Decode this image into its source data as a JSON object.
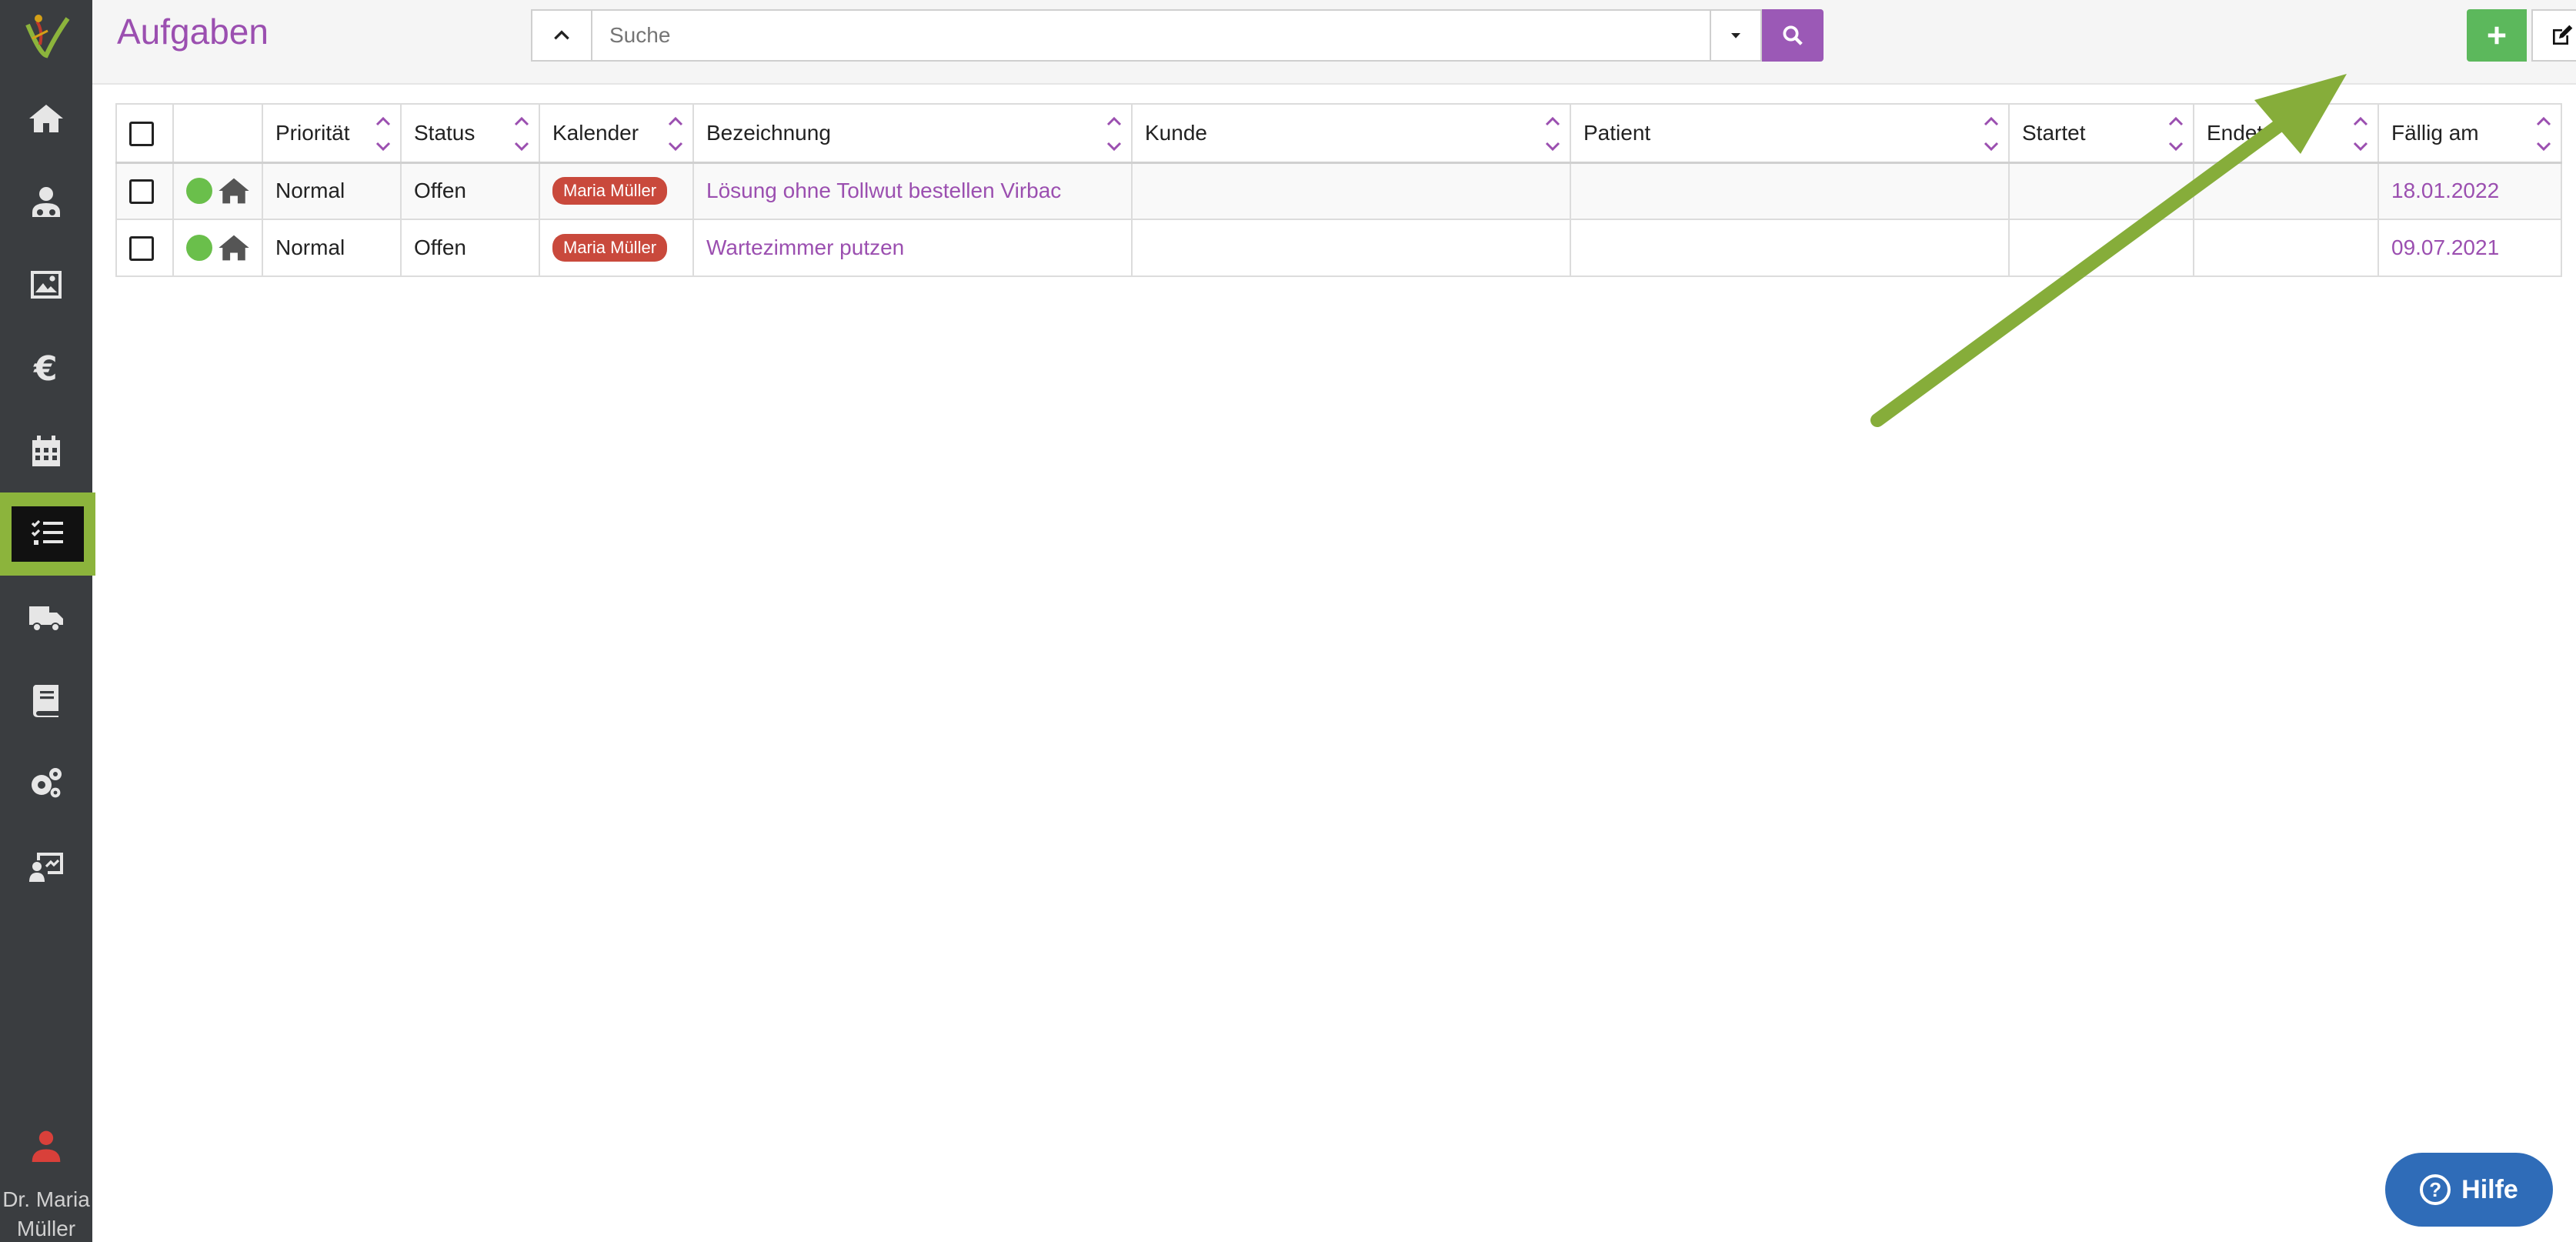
{
  "sidebar": {
    "nav_items": [
      {
        "icon": "home-icon"
      },
      {
        "icon": "customers-icon"
      },
      {
        "icon": "image-icon"
      },
      {
        "icon": "euro-icon"
      },
      {
        "icon": "calendar-icon"
      },
      {
        "icon": "tasks-icon",
        "active": true
      },
      {
        "icon": "truck-icon"
      },
      {
        "icon": "book-icon"
      },
      {
        "icon": "settings-icon"
      },
      {
        "icon": "statistics-icon"
      }
    ],
    "user_name": "Dr. Maria Müller"
  },
  "header": {
    "title": "Aufgaben",
    "search_placeholder": "Suche"
  },
  "table": {
    "columns": [
      "Priorität",
      "Status",
      "Kalender",
      "Bezeichnung",
      "Kunde",
      "Patient",
      "Startet",
      "Endet",
      "Fällig am"
    ],
    "rows": [
      {
        "prioritaet": "Normal",
        "status": "Offen",
        "kalender": "Maria Müller",
        "bezeichnung": "Lösung ohne Tollwut bestellen Virbac",
        "kunde": "",
        "patient": "",
        "startet": "",
        "endet": "",
        "faellig": "18.01.2022"
      },
      {
        "prioritaet": "Normal",
        "status": "Offen",
        "kalender": "Maria Müller",
        "bezeichnung": "Wartezimmer putzen",
        "kunde": "",
        "patient": "",
        "startet": "",
        "endet": "",
        "faellig": "09.07.2021"
      }
    ]
  },
  "help": {
    "label": "Hilfe"
  },
  "colors": {
    "accent": "#9b4fb0",
    "sidebar": "#3a3d40",
    "highlight": "#8cb43c",
    "add": "#5cb85c",
    "delete": "#d9534f",
    "badge": "#c9493c",
    "help": "#2f6cb8"
  }
}
